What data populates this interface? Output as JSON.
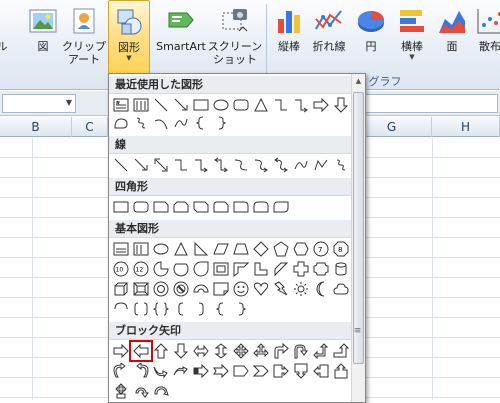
{
  "ribbon": {
    "partial_left_label": "ル",
    "picture_label": "図",
    "clipart_label_1": "クリップ",
    "clipart_label_2": "アート",
    "shapes_label": "図形",
    "smartart_label": "SmartArt",
    "screenshot_label_1": "スクリーン",
    "screenshot_label_2": "ショット",
    "charts": [
      {
        "label": "縦棒"
      },
      {
        "label": "折れ線"
      },
      {
        "label": "円"
      },
      {
        "label": "横棒"
      },
      {
        "label": "面"
      },
      {
        "label": "散布"
      }
    ],
    "charts_group_label": "グラフ"
  },
  "sheet": {
    "columns": [
      "B",
      "C",
      "G",
      "H"
    ]
  },
  "gallery": {
    "sections": {
      "recent": "最近使用した図形",
      "lines": "線",
      "rectangles": "四角形",
      "basic": "基本図形",
      "block_arrows": "ブロック矢印"
    }
  },
  "icons": {
    "shapes": "shapes-icon",
    "picture": "picture-icon",
    "clipart": "clipart-icon",
    "smartart": "smartart-icon",
    "screenshot": "screenshot-icon",
    "selected_shape": "left-arrow-shape-icon"
  },
  "colors": {
    "active_button": "#ffd257",
    "selection_outline": "#e00000",
    "section_header": "#e9edf2"
  }
}
